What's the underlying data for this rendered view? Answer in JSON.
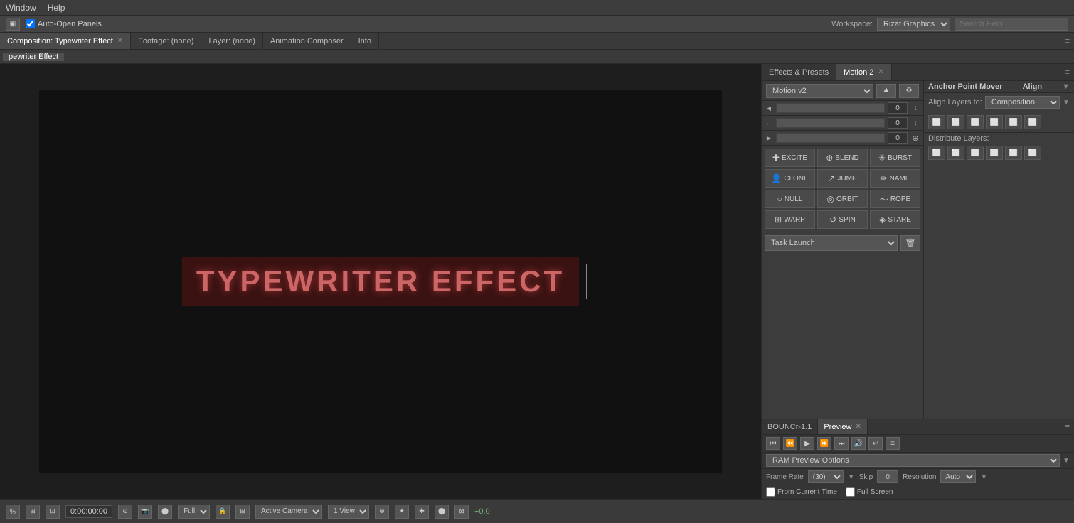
{
  "menuBar": {
    "items": [
      "Window",
      "Help"
    ]
  },
  "toolbar": {
    "autoOpen": "Auto-Open Panels",
    "workspace": {
      "label": "Workspace:",
      "value": "Rizat Graphics"
    },
    "searchPlaceholder": "Search Help"
  },
  "tabs": {
    "composition": "Composition: Typewriter Effect",
    "footage": "Footage: (none)",
    "layer": "Layer: (none)",
    "animComposer": "Animation Composer",
    "info": "Info"
  },
  "secondaryTab": "pewriter Effect",
  "rightPanelTabs": {
    "effectsPresets": "Effects & Presets",
    "motion2": "Motion 2"
  },
  "motionPanel": {
    "selectValue": "Motion v2",
    "sliders": [
      {
        "value": "0"
      },
      {
        "value": "0"
      },
      {
        "value": "0"
      }
    ],
    "buttons": [
      {
        "icon": "+",
        "label": "EXCITE"
      },
      {
        "icon": "⊕",
        "label": "BLEND"
      },
      {
        "icon": "✳",
        "label": "BURST"
      },
      {
        "icon": "👤",
        "label": "CLONE"
      },
      {
        "icon": "↗",
        "label": "JUMP"
      },
      {
        "icon": "✏",
        "label": "NAME"
      },
      {
        "icon": "○",
        "label": "NULL"
      },
      {
        "icon": "◎",
        "label": "ORBIT"
      },
      {
        "icon": "〜",
        "label": "ROPE"
      },
      {
        "icon": "⊞",
        "label": "WARP"
      },
      {
        "icon": "↺",
        "label": "SPIN"
      },
      {
        "icon": "◈",
        "label": "STARE"
      }
    ],
    "taskLaunch": "Task Launch"
  },
  "alignPanel": {
    "title": "Anchor Point Mover",
    "alignTitle": "Align",
    "alignLayersTo": "Align Layers to:",
    "alignLayersToValue": "Composition",
    "distributeLabel": "Distribute Layers:"
  },
  "previewPanel": {
    "tabs": [
      "BOUNCr-1.1",
      "Preview"
    ],
    "optionsLabel": "RAM Preview Options",
    "frameRate": {
      "label": "Frame Rate",
      "value": "(30)"
    },
    "skip": {
      "label": "Skip",
      "value": "0"
    },
    "resolution": {
      "label": "Resolution",
      "value": "Auto"
    },
    "fromCurrentTime": "From Current Time",
    "fullScreen": "Full Screen"
  },
  "viewport": {
    "text": "TYPEWRITER EFFECT"
  },
  "bottomBar": {
    "time": "0:00:00:00",
    "quality": "Full",
    "view": "Active Camera",
    "viewCount": "1 View",
    "zoom": "+0.0"
  }
}
